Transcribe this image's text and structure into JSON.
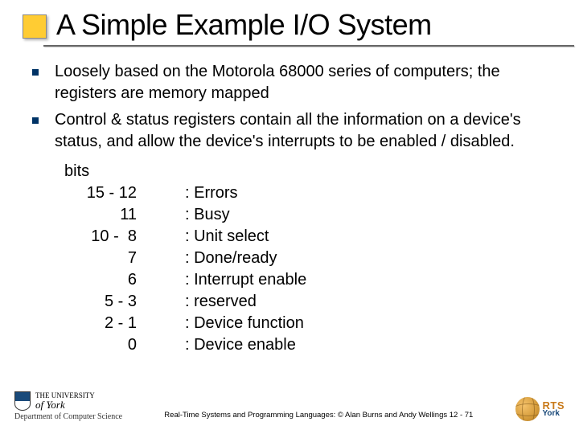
{
  "title": "A Simple Example I/O System",
  "bullets": [
    "Loosely based on the Motorola 68000 series of computers; the registers are memory mapped",
    "Control & status registers contain all the information on a device's status, and allow the device's interrupts to be enabled / disabled."
  ],
  "bits": {
    "header": "bits",
    "rows": [
      {
        "range": "15 - 12",
        "desc": ": Errors"
      },
      {
        "range": "11",
        "desc": ": Busy"
      },
      {
        "range": "10 -  8",
        "desc": ": Unit select"
      },
      {
        "range": "7",
        "desc": ": Done/ready"
      },
      {
        "range": "6",
        "desc": ": Interrupt enable"
      },
      {
        "range": "5 - 3",
        "desc": ": reserved"
      },
      {
        "range": "2 - 1",
        "desc": ": Device function"
      },
      {
        "range": "0",
        "desc": ": Device enable"
      }
    ]
  },
  "footer": {
    "uni_line1": "THE UNIVERSITY",
    "uni_line2": "of York",
    "dept": "Department of Computer Science",
    "credit": "Real-Time Systems and Programming Languages: © Alan Burns and Andy Wellings  12 - 71",
    "rts": "RTS",
    "york": "York"
  }
}
